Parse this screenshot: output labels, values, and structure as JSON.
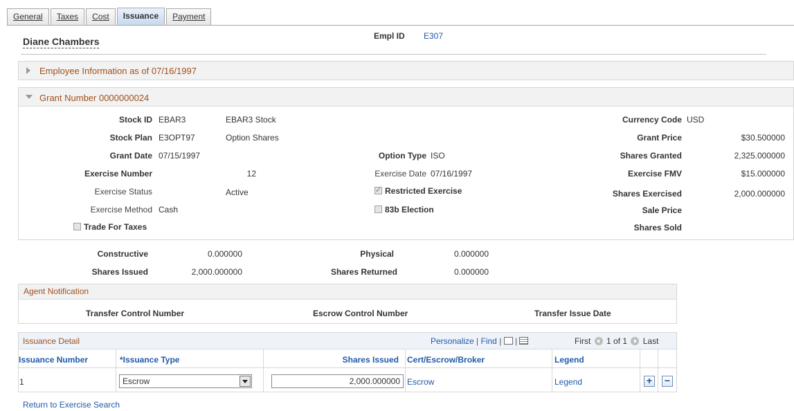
{
  "tabs": [
    {
      "label": "General",
      "active": false
    },
    {
      "label": "Taxes",
      "active": false
    },
    {
      "label": "Cost",
      "active": false
    },
    {
      "label": "Issuance",
      "active": true
    },
    {
      "label": "Payment",
      "active": false
    }
  ],
  "employee": {
    "name": "Diane Chambers",
    "empl_id_label": "Empl ID",
    "empl_id": "E307"
  },
  "employee_info_section": "Employee Information as of 07/16/1997",
  "grant_section": {
    "title": "Grant Number 0000000024",
    "stock_id_label": "Stock ID",
    "stock_id": "EBAR3",
    "stock_id_desc": "EBAR3 Stock",
    "stock_plan_label": "Stock Plan",
    "stock_plan": "E3OPT97",
    "stock_plan_desc": "Option Shares",
    "grant_date_label": "Grant Date",
    "grant_date": "07/15/1997",
    "exercise_number_label": "Exercise Number",
    "exercise_number": "12",
    "exercise_status_label": "Exercise Status",
    "exercise_status": "Active",
    "exercise_method_label": "Exercise Method",
    "exercise_method": "Cash",
    "trade_for_taxes_label": "Trade For Taxes",
    "option_type_label": "Option Type",
    "option_type": "ISO",
    "exercise_date_label": "Exercise Date",
    "exercise_date": "07/16/1997",
    "restricted_exercise_label": "Restricted Exercise",
    "election_83b_label": "83b Election",
    "currency_code_label": "Currency Code",
    "currency_code": "USD",
    "grant_price_label": "Grant Price",
    "grant_price": "$30.500000",
    "shares_granted_label": "Shares Granted",
    "shares_granted": "2,325.000000",
    "exercise_fmv_label": "Exercise FMV",
    "exercise_fmv": "$15.000000",
    "shares_exercised_label": "Shares Exercised",
    "shares_exercised": "2,000.000000",
    "sale_price_label": "Sale Price",
    "shares_sold_label": "Shares Sold"
  },
  "totals": {
    "constructive_label": "Constructive",
    "constructive": "0.000000",
    "physical_label": "Physical",
    "physical": "0.000000",
    "shares_issued_label": "Shares Issued",
    "shares_issued": "2,000.000000",
    "shares_returned_label": "Shares Returned",
    "shares_returned": "0.000000"
  },
  "agent_notification": {
    "title": "Agent Notification",
    "transfer_control_label": "Transfer Control Number",
    "escrow_control_label": "Escrow Control Number",
    "transfer_issue_date_label": "Transfer Issue Date"
  },
  "issuance_detail": {
    "title": "Issuance Detail",
    "personalize": "Personalize",
    "separator": "|",
    "find": "Find",
    "first": "First",
    "range": "1 of 1",
    "last": "Last",
    "columns": {
      "issuance_number": "Issuance Number",
      "issuance_type": "*Issuance Type",
      "shares_issued": "Shares Issued",
      "cert_escrow_broker": "Cert/Escrow/Broker",
      "legend": "Legend"
    },
    "rows": [
      {
        "issuance_number": "1",
        "issuance_type": "Escrow",
        "shares_issued": "2,000.000000",
        "cert_escrow_broker": "Escrow",
        "legend": "Legend"
      }
    ],
    "add_symbol": "+",
    "delete_symbol": "−"
  },
  "return_link": "Return to Exercise Search"
}
